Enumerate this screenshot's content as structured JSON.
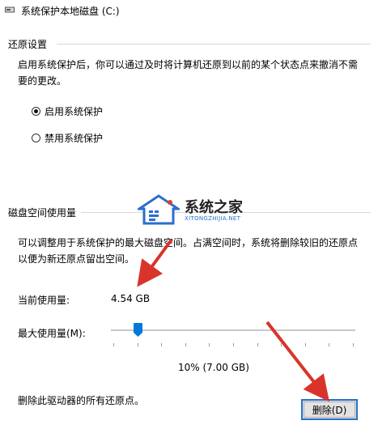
{
  "window": {
    "title": "系统保护本地磁盘 (C:)",
    "icon": "drive-icon"
  },
  "restore_settings": {
    "group_title": "还原设置",
    "description_line1": "启用系统保护后，你可以通过及时将计算机还原到以前的某个状态点来撤消不需",
    "description_line2": "要的更改。",
    "options": [
      {
        "label": "启用系统保护",
        "checked": true
      },
      {
        "label": "禁用系统保护",
        "checked": false
      }
    ]
  },
  "disk_usage": {
    "group_title": "磁盘空间使用量",
    "description_line1": "可以调整用于系统保护的最大磁盘空间。占满空间时，系统将删除较旧的还原点",
    "description_line2": "以便为新还原点留出空间。",
    "current_usage_label": "当前使用量:",
    "current_usage_value": "4.54 GB",
    "max_usage_label": "最大使用量(M):",
    "slider_value_fraction": 0.1,
    "slider_readout": "10% (7.00 GB)",
    "delete_description": "删除此驱动器的所有还原点。",
    "delete_button_label": "删除(D)"
  },
  "watermark": {
    "title": "系统之家",
    "subtitle": "XITONGZHIJIA.NET"
  },
  "colors": {
    "accent": "#0078d7",
    "arrow": "#d9342b",
    "button_border": "#2a6fcc",
    "watermark_blue": "#2a6fcc"
  }
}
